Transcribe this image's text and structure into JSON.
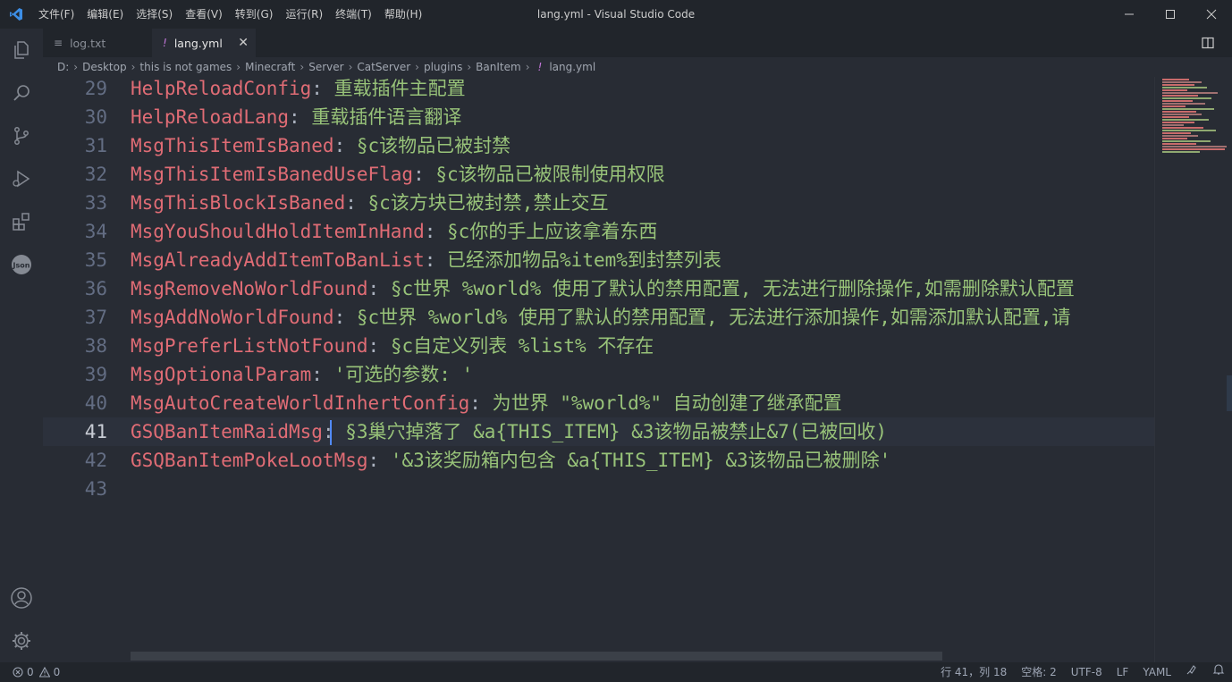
{
  "window": {
    "title": "lang.yml - Visual Studio Code",
    "menu": [
      "文件(F)",
      "编辑(E)",
      "选择(S)",
      "查看(V)",
      "转到(G)",
      "运行(R)",
      "终端(T)",
      "帮助(H)"
    ]
  },
  "tabs": [
    {
      "label": "log.txt",
      "icon": "≡",
      "active": false
    },
    {
      "label": "lang.yml",
      "icon": "!",
      "active": true,
      "close": "✕"
    }
  ],
  "breadcrumb": [
    "D:",
    "Desktop",
    "this is not games",
    "Minecraft",
    "Server",
    "CatServer",
    "plugins",
    "BanItem",
    "lang.yml"
  ],
  "editor": {
    "lines": [
      {
        "n": "29",
        "key": "HelpReloadConfig",
        "val": " 重载插件主配置"
      },
      {
        "n": "30",
        "key": "HelpReloadLang",
        "val": " 重载插件语言翻译"
      },
      {
        "n": "31",
        "key": "MsgThisItemIsBaned",
        "val": " §c该物品已被封禁"
      },
      {
        "n": "32",
        "key": "MsgThisItemIsBanedUseFlag",
        "val": " §c该物品已被限制使用权限"
      },
      {
        "n": "33",
        "key": "MsgThisBlockIsBaned",
        "val": " §c该方块已被封禁,禁止交互"
      },
      {
        "n": "34",
        "key": "MsgYouShouldHoldItemInHand",
        "val": " §c你的手上应该拿着东西"
      },
      {
        "n": "35",
        "key": "MsgAlreadyAddItemToBanList",
        "val": " 已经添加物品%item%到封禁列表"
      },
      {
        "n": "36",
        "key": "MsgRemoveNoWorldFound",
        "val": " §c世界 %world% 使用了默认的禁用配置, 无法进行删除操作,如需删除默认配置"
      },
      {
        "n": "37",
        "key": "MsgAddNoWorldFound",
        "val": " §c世界 %world% 使用了默认的禁用配置, 无法进行添加操作,如需添加默认配置,请"
      },
      {
        "n": "38",
        "key": "MsgPreferListNotFound",
        "val": " §c自定义列表 %list% 不存在"
      },
      {
        "n": "39",
        "key": "MsgOptionalParam",
        "val": " '可选的参数: '"
      },
      {
        "n": "40",
        "key": "MsgAutoCreateWorldInhertConfig",
        "val": " 为世界 \"%world%\" 自动创建了继承配置"
      },
      {
        "n": "41",
        "key": "GSQBanItemRaidMsg",
        "val": " §3巢穴掉落了 &a{THIS_ITEM} &3该物品被禁止&7(已被回收)"
      },
      {
        "n": "42",
        "key": "GSQBanItemPokeLootMsg",
        "val": " '&3该奖励箱内包含 &a{THIS_ITEM} &3该物品已被删除'"
      },
      {
        "n": "43",
        "key": "",
        "val": ""
      }
    ],
    "current_line": "41"
  },
  "statusbar": {
    "errors": "0",
    "warnings": "0",
    "position": "行 41，列 18",
    "indent": "空格: 2",
    "encoding": "UTF-8",
    "eol": "LF",
    "language": "YAML"
  },
  "colors": {
    "key": "#e06c75",
    "value": "#98c379",
    "background": "#282c34",
    "chrome": "#21252b",
    "accent": "#3c8ee6"
  }
}
